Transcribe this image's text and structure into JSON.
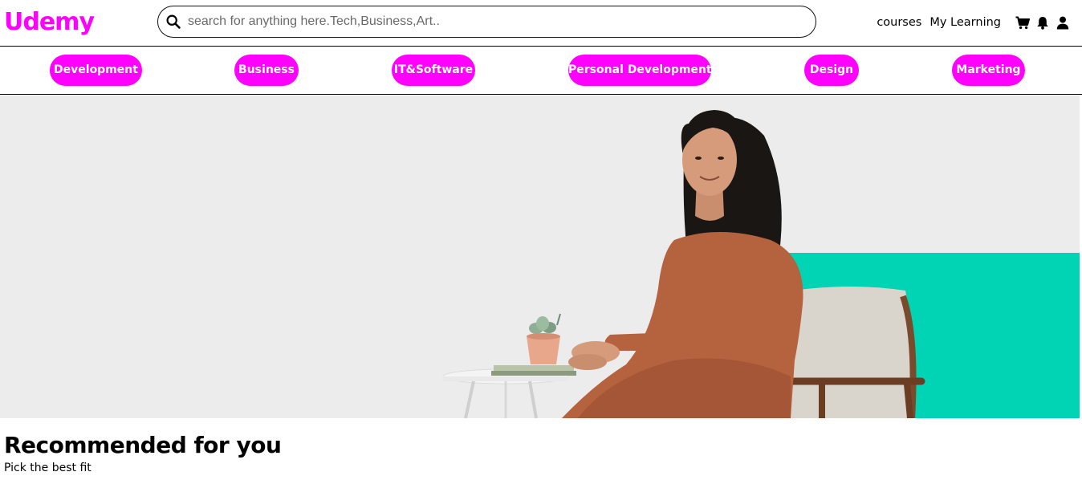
{
  "header": {
    "logo": "Udemy",
    "search": {
      "placeholder": "search for anything here.Tech,Business,Art..",
      "value": "",
      "icon": "search-icon"
    },
    "nav": {
      "courses": "courses",
      "my_learning": "My Learning",
      "icons": [
        "cart-icon",
        "bell-icon",
        "user-icon"
      ]
    }
  },
  "categories": [
    {
      "label": "Development"
    },
    {
      "label": "Business"
    },
    {
      "label": "IT&Software"
    },
    {
      "label": "Personal Development"
    },
    {
      "label": "Design"
    },
    {
      "label": "Marketing"
    }
  ],
  "hero": {
    "image": "woman-sitting-in-armchair-photo"
  },
  "recommended": {
    "title": "Recommended for you",
    "subtitle": "Pick the best fit"
  },
  "colors": {
    "brand": "#ff00ff",
    "hero_background": "#ececec",
    "hero_accent": "#00d4b4"
  }
}
